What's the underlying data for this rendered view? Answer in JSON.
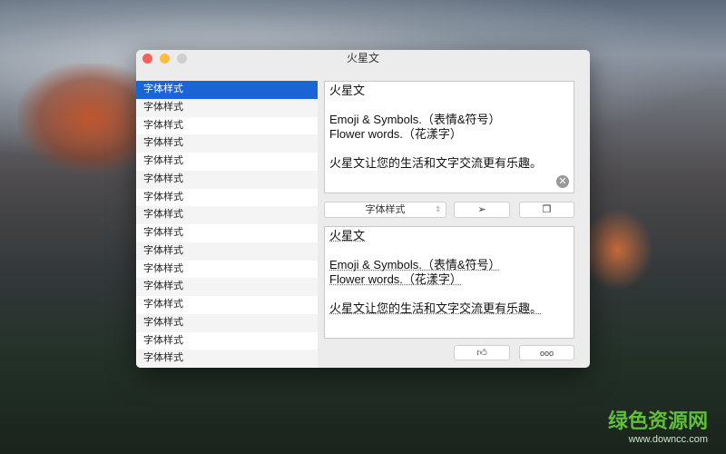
{
  "window": {
    "title": "火星文"
  },
  "colors": {
    "close": "#fc605c",
    "minimize": "#fdbc40",
    "zoom": "#cfcfcf",
    "selection": "#1a64d6"
  },
  "list": {
    "items": [
      "字体样式",
      "字体样式",
      "字体样式",
      "字体样式",
      "字体样式",
      "字体样式",
      "字体样式",
      "字体样式",
      "字体样式",
      "字体样式",
      "字体样式",
      "字体样式",
      "字体样式",
      "字体样式",
      "字体样式",
      "字体样式"
    ]
  },
  "input": {
    "line1": "火星文",
    "line2": "Emoji & Symbols.（表情&符号）",
    "line3": "Flower words.（花漾字）",
    "line4": "火星文让您的生活和文字交流更有乐趣。"
  },
  "toolbar": {
    "style_select": "字体样式",
    "send_icon": "paper-plane",
    "copy_icon": "copy"
  },
  "output": {
    "line1": "火星文",
    "line2": "Emoji & Symbols.（表情&符号）",
    "line3": "Flower words.（花漾字）",
    "line4": "火星文让您的生活和文字交流更有乐趣。"
  },
  "bottom": {
    "like_icon": "thumbs-up",
    "more_label": "ooo"
  },
  "watermark": {
    "name": "绿色资源网",
    "url": "www.downcc.com"
  }
}
